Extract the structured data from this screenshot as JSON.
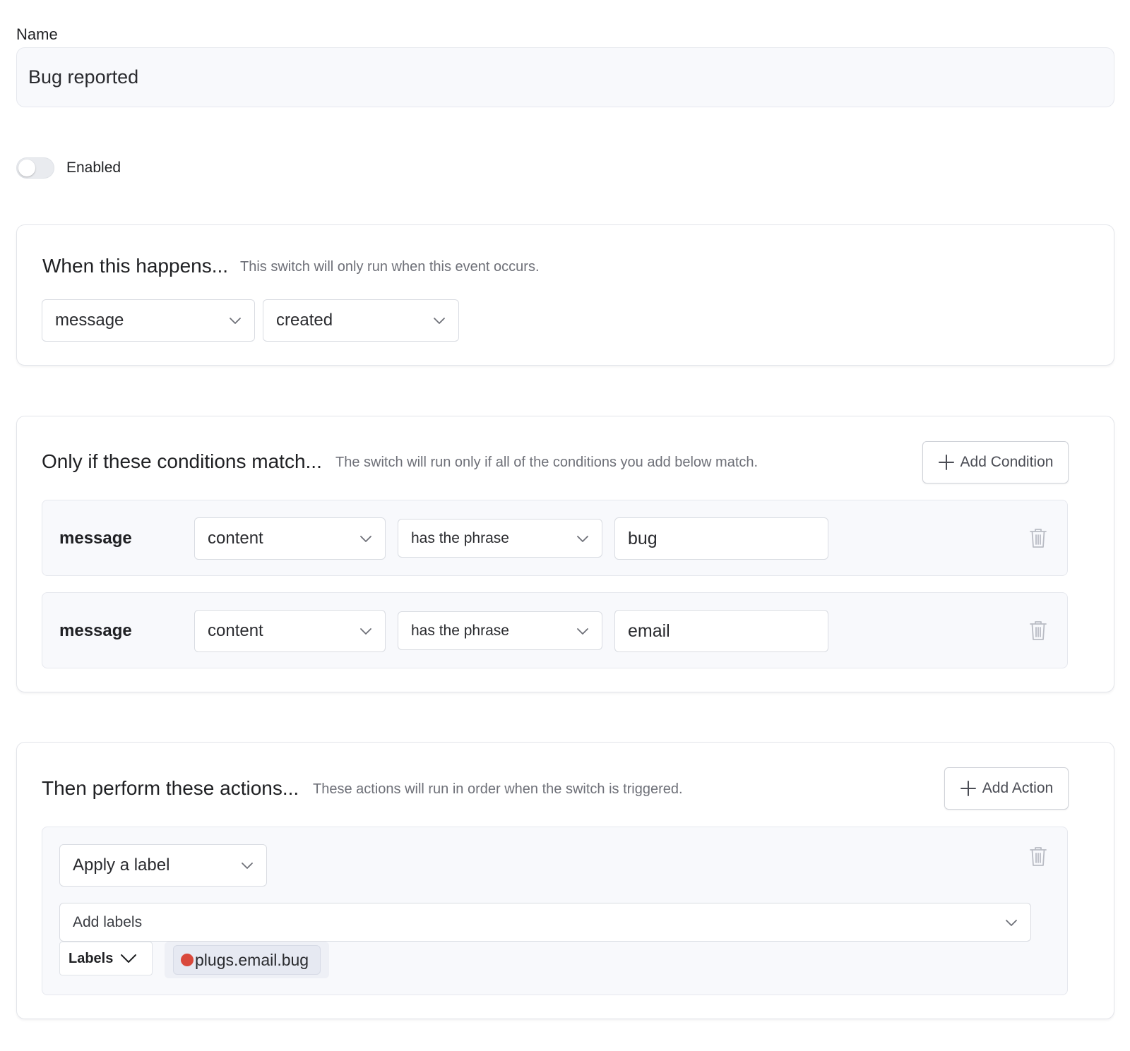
{
  "name_field": {
    "label": "Name",
    "value": "Bug reported"
  },
  "enabled_toggle": {
    "label": "Enabled",
    "state": "off"
  },
  "trigger": {
    "title": "When this happens...",
    "description": "This switch will only run when this event occurs.",
    "object_select": "message",
    "event_select": "created"
  },
  "conditions": {
    "title": "Only if these conditions match...",
    "description": "The switch will run only if all of the conditions you add below match.",
    "add_button": "Add Condition",
    "rows": [
      {
        "subject": "message",
        "field": "content",
        "operator": "has the phrase",
        "value": "bug"
      },
      {
        "subject": "message",
        "field": "content",
        "operator": "has the phrase",
        "value": "email"
      }
    ]
  },
  "actions": {
    "title": "Then perform these actions...",
    "description": "These actions will run in order when the switch is triggered.",
    "add_button": "Add Action",
    "items": [
      {
        "type_select": "Apply a label",
        "labels_placeholder": "Add labels",
        "labels_toggle": "Labels",
        "chips": [
          {
            "text": "plugs.email.bug",
            "color": "#d9483b"
          }
        ]
      }
    ]
  },
  "icons": {
    "chevron": "chevron-down-icon",
    "plus": "plus-icon",
    "trash": "trash-icon"
  }
}
